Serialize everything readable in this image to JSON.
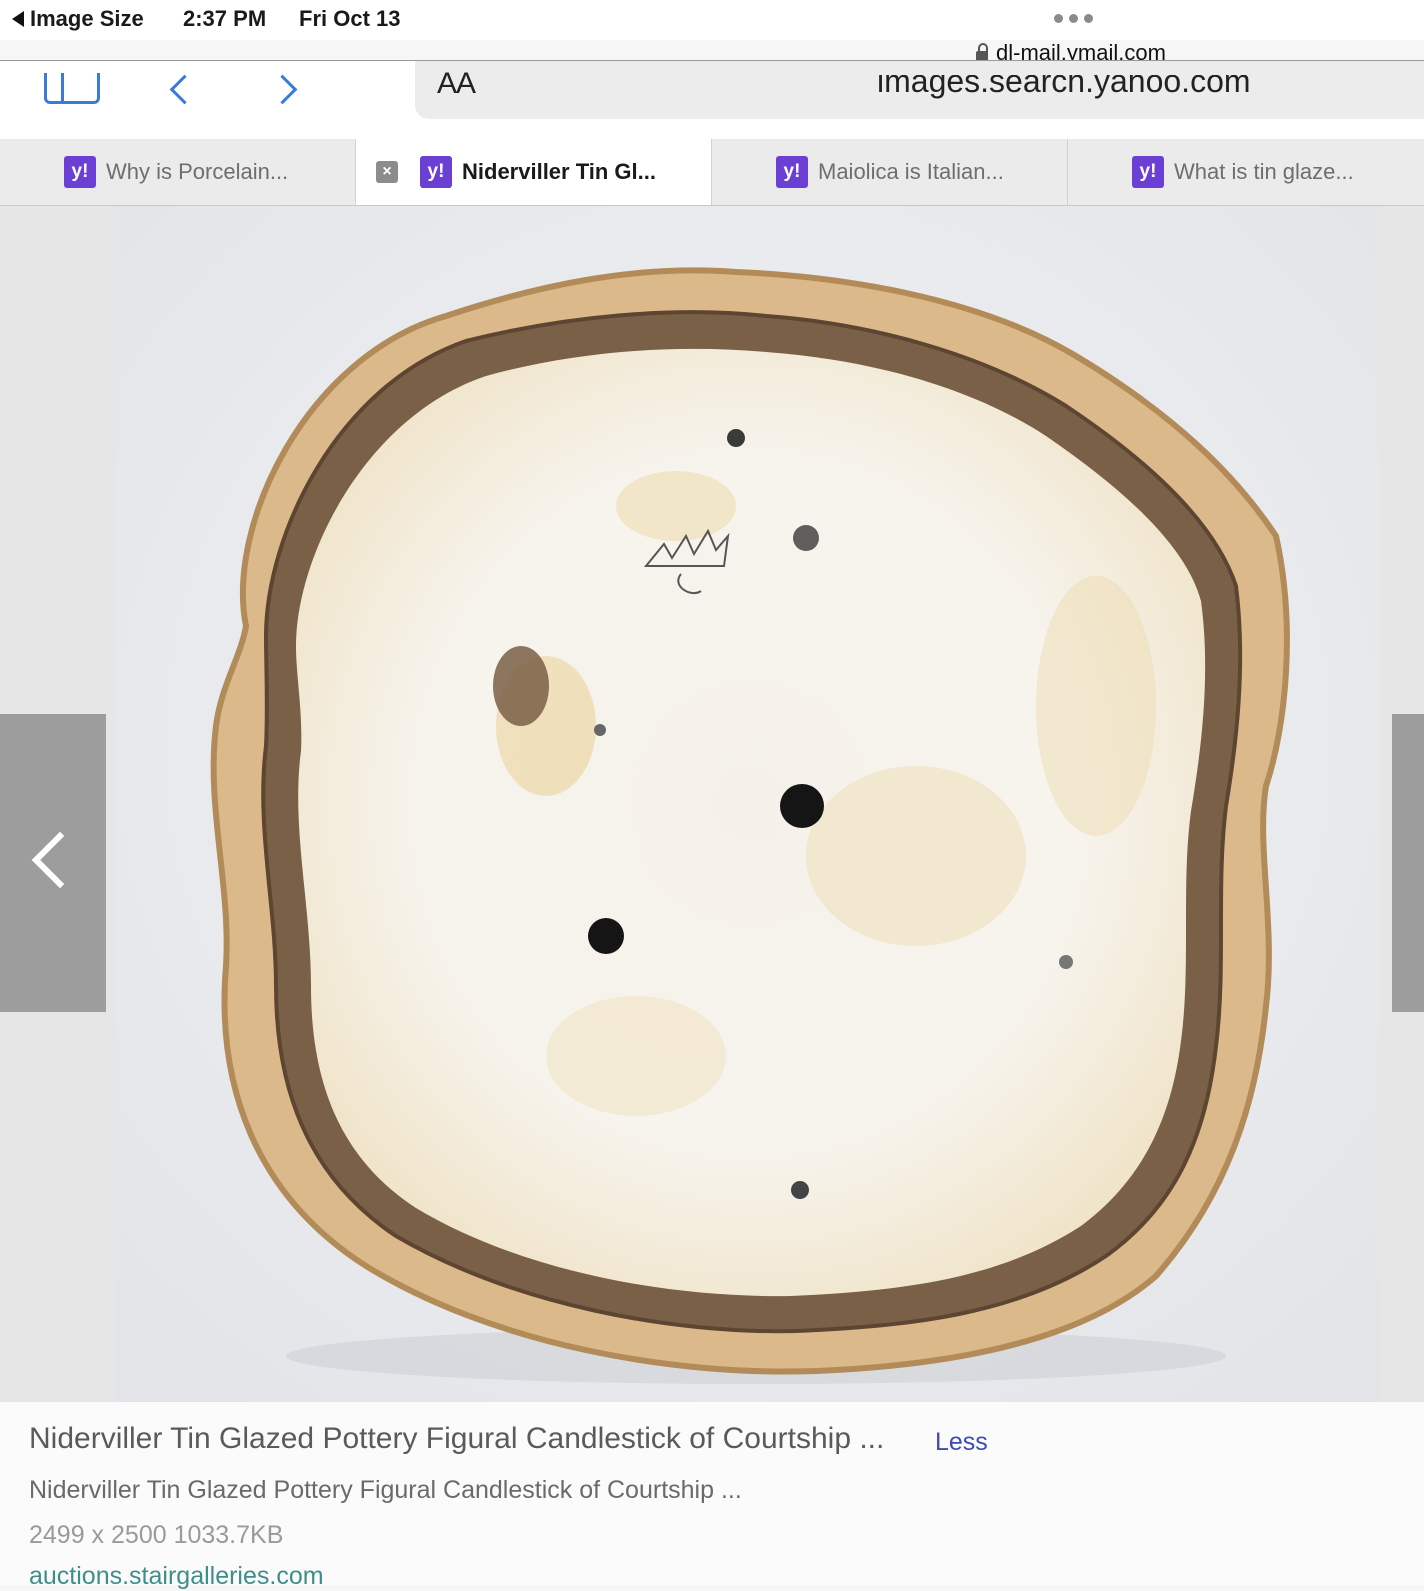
{
  "status_bar": {
    "back_label": "Image Size",
    "time": "2:37 PM",
    "date": "Fri Oct 13",
    "domain": "dl-mail.ymail.com"
  },
  "toolbar": {
    "reader_label": "AA",
    "url": "images.search.yahoo.com"
  },
  "tabs": [
    {
      "label": "Why is Porcelain...",
      "favicon": "y!"
    },
    {
      "label": "Niderviller Tin Gl...",
      "favicon": "y!"
    },
    {
      "label": "Maiolica is Italian...",
      "favicon": "y!"
    },
    {
      "label": "What is tin glaze...",
      "favicon": "y!"
    }
  ],
  "tab_close_glyph": "×",
  "image": {
    "description_icon": "ceramic-bowl-photo"
  },
  "caption": {
    "title": "Niderviller Tin Glazed Pottery Figural Candlestick of Courtship ...",
    "less_label": "Less",
    "subtitle": "Niderviller Tin Glazed Pottery Figural Candlestick of Courtship ...",
    "size_info": "2499 x 2500 1033.7KB",
    "source": "auctions.stairgalleries.com"
  },
  "colors": {
    "accent": "#3a7bd5",
    "yahoo_purple": "#6b3fd4",
    "link": "#3e4bb0"
  }
}
